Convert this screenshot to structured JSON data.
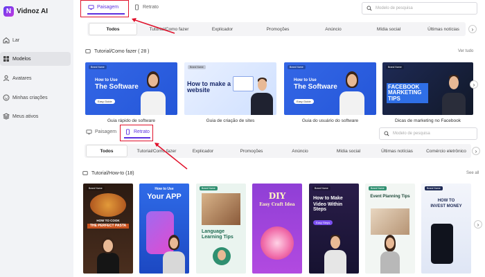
{
  "brand": {
    "name": "Vidnoz AI"
  },
  "sidebar": {
    "items": [
      {
        "label": "Lar",
        "icon": "home-icon"
      },
      {
        "label": "Modelos",
        "icon": "grid-icon",
        "active": true
      },
      {
        "label": "Avatares",
        "icon": "person-icon"
      },
      {
        "label": "Minhas criações",
        "icon": "face-icon"
      },
      {
        "label": "Meus ativos",
        "icon": "layers-icon"
      }
    ]
  },
  "top": {
    "tabs": [
      "Paisagem",
      "Retrato"
    ],
    "selected": "Paisagem",
    "search_placeholder": "Modelo de pesquisa",
    "categories": [
      "Todos",
      "Tutorial/Como fazer",
      "Explicador",
      "Promoções",
      "Anúncio",
      "Mídia social",
      "Últimas notícias"
    ],
    "section_title": "Tutorial/Como fazer ( 28 )",
    "see_all": "Ver tudo",
    "cards": [
      {
        "caption": "Guia rápido de software",
        "brand": "Brand Name",
        "headline_small": "How to Use",
        "headline_big": "The Software",
        "pill": "Easy Guide"
      },
      {
        "caption": "Guia de criação de sites",
        "brand": "Brand Name",
        "headline": "How to make a website"
      },
      {
        "caption": "Guia do usuário do software",
        "brand": "Brand Name",
        "headline_small": "How to Use",
        "headline_big": "The Software",
        "pill": "Easy Guide"
      },
      {
        "caption": "Dicas de marketing no Facebook",
        "brand": "Brand Name",
        "headline_big": "FACEBOOK MARKETING TIPS"
      }
    ]
  },
  "bottom": {
    "tabs": [
      "Paisagem",
      "Retrato"
    ],
    "selected": "Retrato",
    "search_placeholder": "Modelo de pesquisa",
    "categories": [
      "Todos",
      "Tutorial/Como fazer",
      "Explicador",
      "Promoções",
      "Anúncio",
      "Mídia social",
      "Últimas notícias",
      "Comércio eletrônico"
    ],
    "section_title": "Tutorial/How-to (18)",
    "see_all": "See all",
    "cards": [
      {
        "brand": "Brand Name",
        "line1": "HOW TO COOK",
        "line2": "THE PERFECT PASTA"
      },
      {
        "line1": "How to Use",
        "line2": "Your APP"
      },
      {
        "brand": "Brand Name",
        "line1": "Language",
        "line2": "Learning Tips"
      },
      {
        "line1": "DIY",
        "line2": "Easy Craft Idea"
      },
      {
        "brand": "Brand Name",
        "line1": "How to Make",
        "line2": "Video Within Steps",
        "pill": "Easy Steps"
      },
      {
        "brand": "Brand Name",
        "line1": "Event Planning Tips"
      },
      {
        "brand": "Brand Name",
        "line1": "HOW TO",
        "line2": "INVEST MONEY"
      }
    ]
  },
  "colors": {
    "accent": "#5b2fe0",
    "annotation": "#e0102a"
  }
}
